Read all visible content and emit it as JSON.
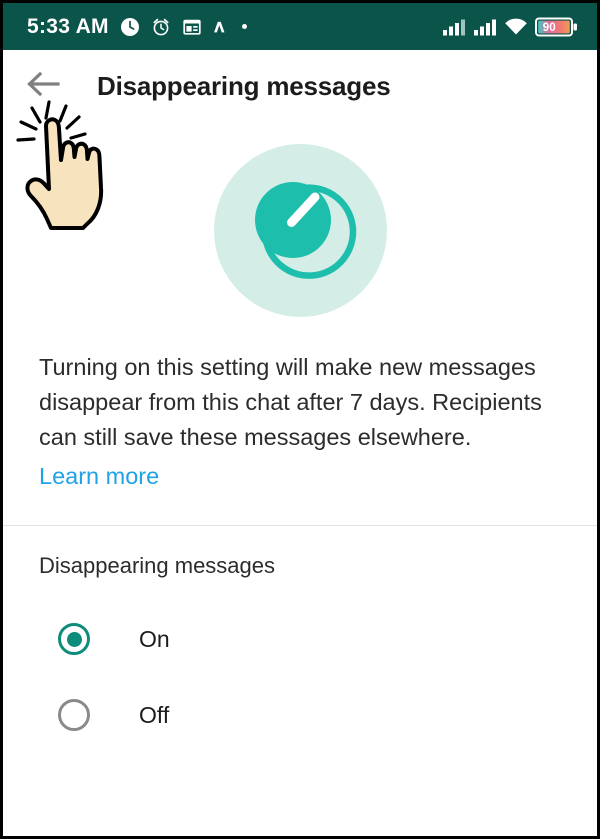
{
  "status_bar": {
    "time": "5:33 AM",
    "background_color": "#0B5449",
    "icons": [
      "clock-icon",
      "alarm-icon",
      "calendar-icon",
      "caret-up-icon",
      "dot-icon"
    ],
    "signal_icons": [
      "signal-bars-sim1-icon",
      "signal-bars-sim2-icon",
      "wifi-icon"
    ],
    "battery_level": "90"
  },
  "app_bar": {
    "back_label": "back-arrow-icon",
    "title": "Disappearing messages"
  },
  "hero": {
    "icon_name": "timer-icon",
    "circle_color": "#D5EDE7",
    "accent_color": "#1DBFAC"
  },
  "description": {
    "text": "Turning on this setting will make new messages disappear from this chat after 7 days. Recipients can still save these messages elsewhere.",
    "link_label": "Learn more",
    "link_color": "#1FA2E6"
  },
  "settings": {
    "section_label": "Disappearing messages",
    "selected": "On",
    "options": [
      {
        "label": "On",
        "selected": true
      },
      {
        "label": "Off",
        "selected": false
      }
    ],
    "selected_color": "#0E8C7B",
    "unselected_color": "#8a8a8a"
  },
  "overlay": {
    "cursor_name": "tap-hand-cursor",
    "cursor_fill": "#F7E3BE"
  }
}
